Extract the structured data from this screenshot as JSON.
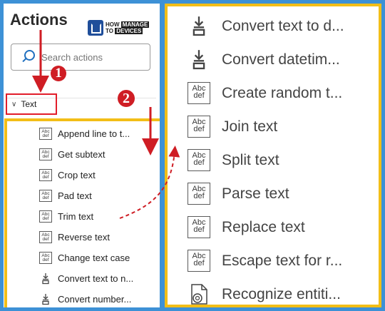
{
  "panel": {
    "title": "Actions",
    "search_placeholder": "Search actions",
    "group_label": "Text",
    "logo": {
      "line1": "HOW",
      "line2": "TO",
      "manage": "MANAGE",
      "devices": "DEVICES"
    }
  },
  "markers": {
    "first": "1",
    "second": "2"
  },
  "left_items": [
    {
      "label": "Append line to t...",
      "icon": "text-action-icon"
    },
    {
      "label": "Get subtext",
      "icon": "text-action-icon"
    },
    {
      "label": "Crop text",
      "icon": "text-action-icon"
    },
    {
      "label": "Pad text",
      "icon": "text-action-icon"
    },
    {
      "label": "Trim text",
      "icon": "text-action-icon"
    },
    {
      "label": "Reverse text",
      "icon": "text-action-icon"
    },
    {
      "label": "Change text case",
      "icon": "text-action-icon"
    },
    {
      "label": "Convert text to n...",
      "icon": "convert-icon"
    },
    {
      "label": "Convert number...",
      "icon": "convert-icon"
    }
  ],
  "right_items": [
    {
      "label": "Convert text to d...",
      "icon": "convert-icon"
    },
    {
      "label": "Convert datetim...",
      "icon": "convert-icon"
    },
    {
      "label": "Create random t...",
      "icon": "text-action-icon"
    },
    {
      "label": "Join text",
      "icon": "text-action-icon"
    },
    {
      "label": "Split text",
      "icon": "text-action-icon"
    },
    {
      "label": "Parse text",
      "icon": "text-action-icon"
    },
    {
      "label": "Replace text",
      "icon": "text-action-icon"
    },
    {
      "label": "Escape text for r...",
      "icon": "text-action-icon"
    },
    {
      "label": "Recognize entiti...",
      "icon": "recognize-icon"
    }
  ],
  "icon_text": {
    "top": "Abc",
    "bottom": "def"
  },
  "colors": {
    "frame": "#3d91d6",
    "highlight": "#f3be17",
    "marker": "#cf1d24"
  }
}
